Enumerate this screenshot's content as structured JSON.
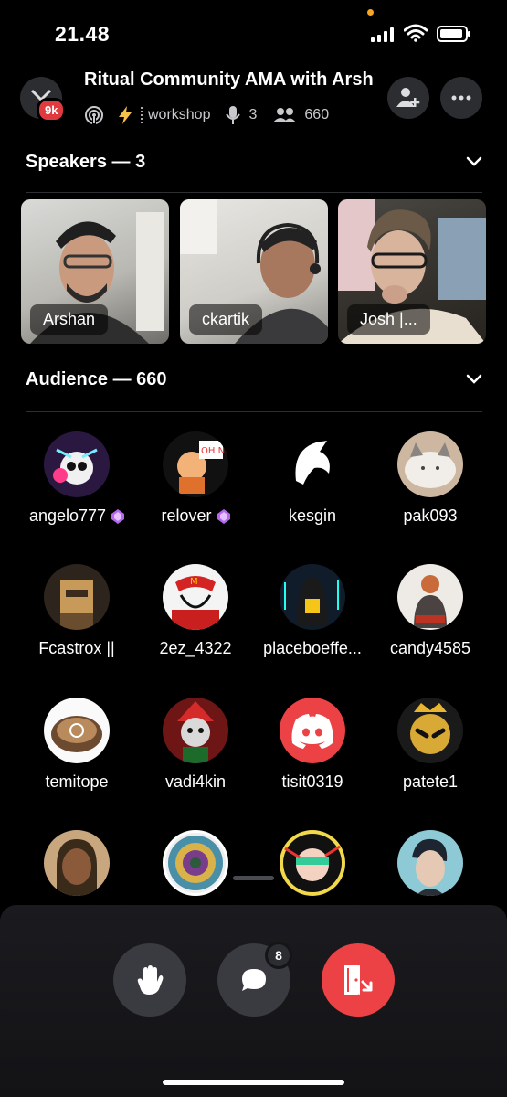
{
  "status_bar": {
    "time": "21.48"
  },
  "header": {
    "title": "Ritual Community AMA with Arsh",
    "server_badge": "9k",
    "category": "workshop",
    "speaker_count": "3",
    "listener_count": "660"
  },
  "speakers": {
    "heading": "Speakers — 3",
    "tiles": [
      {
        "name": "Arshan"
      },
      {
        "name": "ckartik"
      },
      {
        "name": "Josh |..."
      }
    ]
  },
  "audience": {
    "heading": "Audience — 660",
    "members": [
      {
        "name": "angelo777",
        "color": "#3b2350"
      },
      {
        "name": "relover",
        "color": "#1e1e22"
      },
      {
        "name": "kesgin",
        "color": "#000000"
      },
      {
        "name": "pak093",
        "color": "#d8c9b8"
      },
      {
        "name": "Fcastrox ||",
        "color": "#3a2e24"
      },
      {
        "name": "2ez_4322",
        "color": "#f2f2f2"
      },
      {
        "name": "placeboeffe...",
        "color": "#1a2f3a"
      },
      {
        "name": "candy4585",
        "color": "#f0ece8"
      },
      {
        "name": "temitope",
        "color": "#f5f5f5"
      },
      {
        "name": "vadi4kin",
        "color": "#8a1c1c"
      },
      {
        "name": "tisit0319",
        "color": "#ed4245"
      },
      {
        "name": "patete1",
        "color": "#1c1c1c"
      }
    ]
  },
  "controls": {
    "chat_unread": "8"
  },
  "colors": {
    "accent_red": "#ed4245",
    "nitro_gem": "#c77dff",
    "surface": "#2b2d31"
  }
}
